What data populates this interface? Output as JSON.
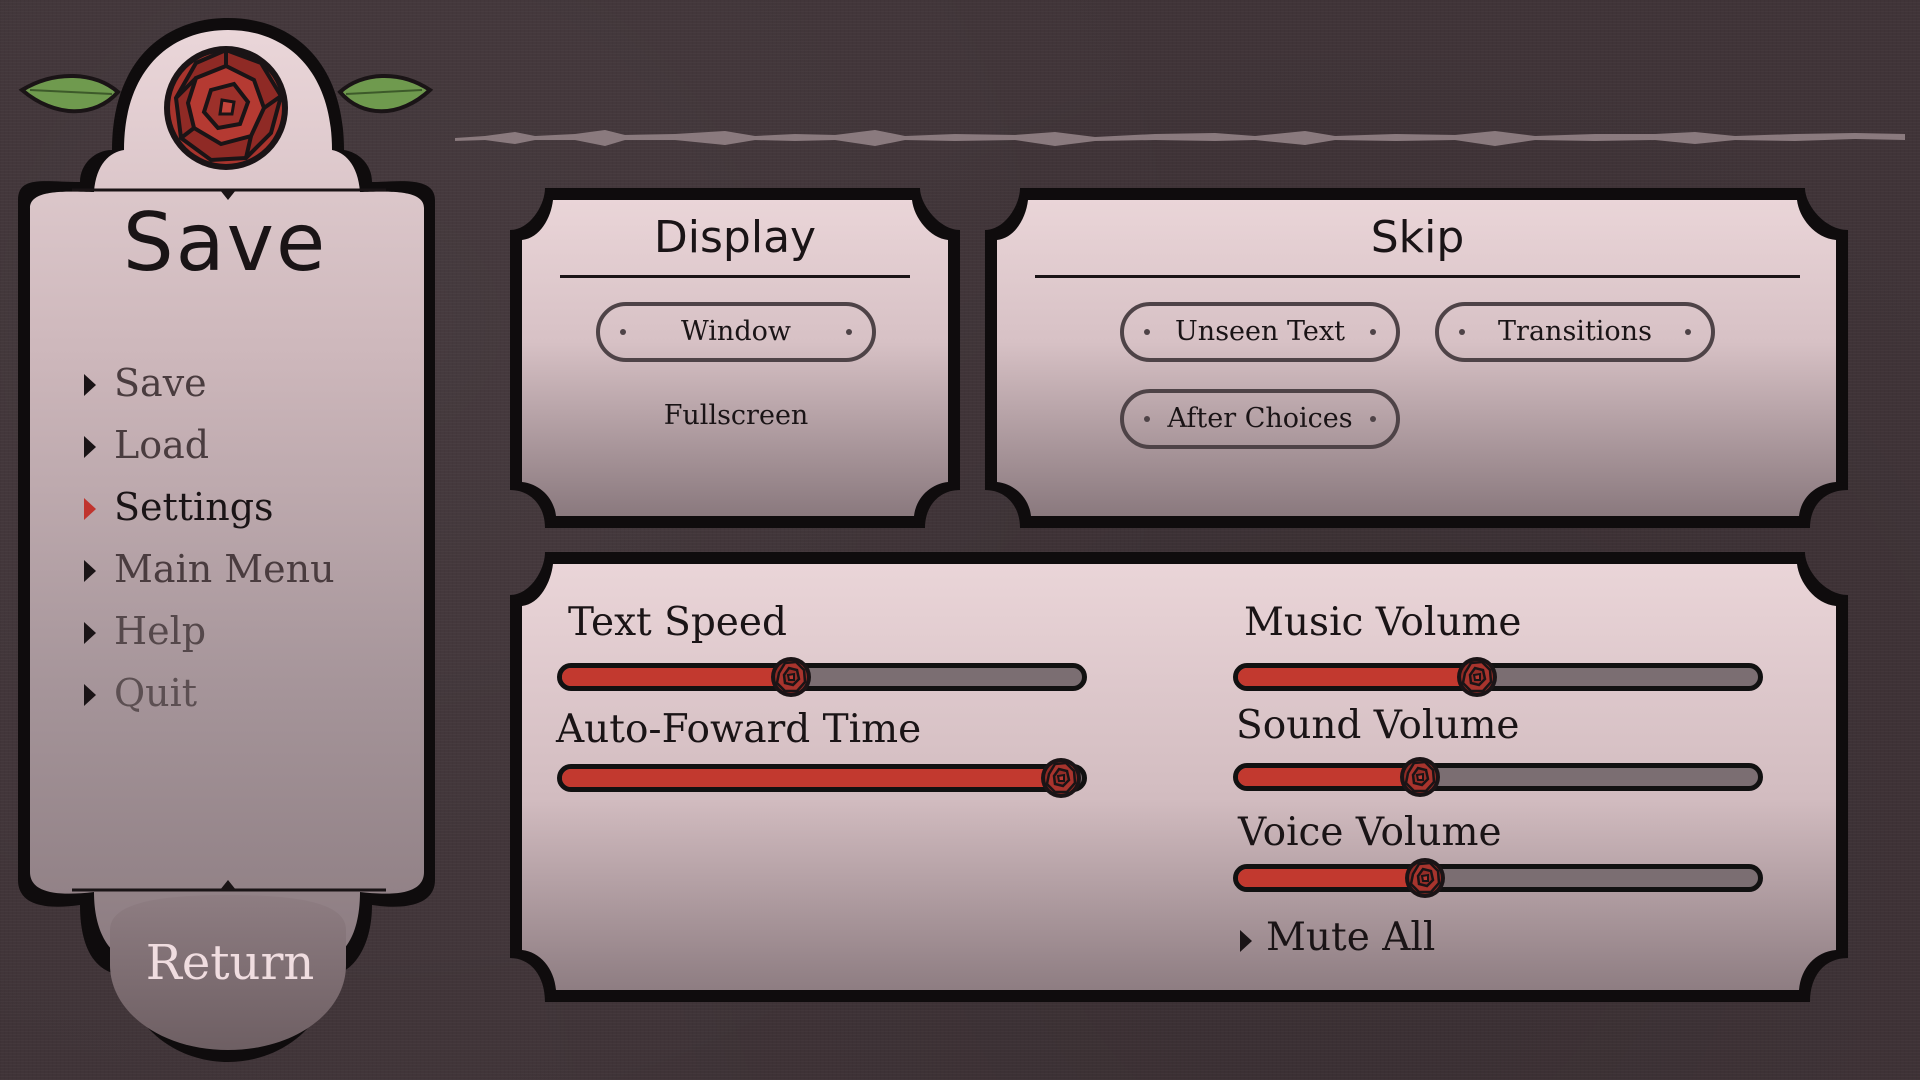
{
  "sidebar": {
    "title": "Save",
    "items": [
      {
        "label": "Save"
      },
      {
        "label": "Load"
      },
      {
        "label": "Settings"
      },
      {
        "label": "Main Menu"
      },
      {
        "label": "Help"
      },
      {
        "label": "Quit"
      }
    ],
    "active_item": "Settings",
    "return_label": "Return"
  },
  "display_panel": {
    "title": "Display",
    "options": [
      {
        "label": "Window",
        "selected": true
      },
      {
        "label": "Fullscreen",
        "selected": false
      }
    ]
  },
  "skip_panel": {
    "title": "Skip",
    "options": [
      {
        "label": "Unseen Text",
        "selected": true
      },
      {
        "label": "Transitions",
        "selected": true
      },
      {
        "label": "After Choices",
        "selected": true
      }
    ]
  },
  "sliders": {
    "text_speed": {
      "label": "Text Speed",
      "value": 0.44
    },
    "auto_forward": {
      "label": "Auto-Foward Time",
      "value": 0.96
    },
    "music_volume": {
      "label": "Music Volume",
      "value": 0.46
    },
    "sound_volume": {
      "label": "Sound Volume",
      "value": 0.35
    },
    "voice_volume": {
      "label": "Voice Volume",
      "value": 0.36
    }
  },
  "mute_all_label": "Mute All",
  "colors": {
    "background": "#403438",
    "panel_top": "#e8d2d5",
    "panel_bottom": "#8b7a7f",
    "accent_red": "#c2392f",
    "border": "#111111"
  },
  "icons": {
    "header_ornament": "rose-icon",
    "slider_thumb": "rose-knob-icon",
    "nav_marker": "triangle-right-icon"
  }
}
